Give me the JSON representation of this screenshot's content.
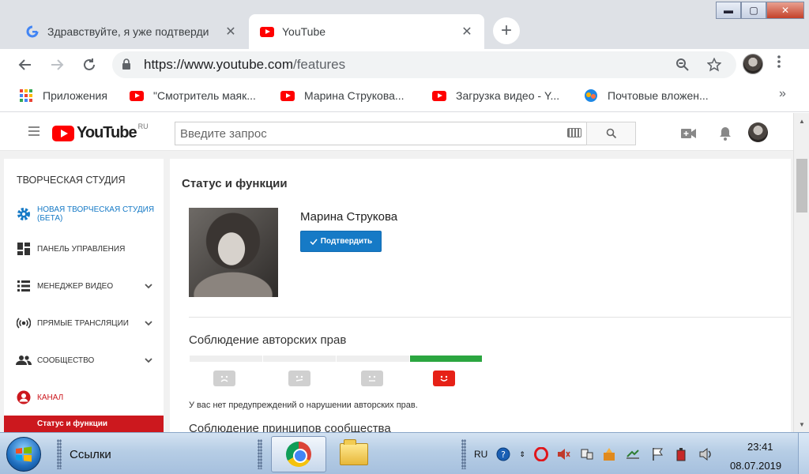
{
  "browser": {
    "tabs": [
      {
        "title": "Здравствуйте, я уже подтверди",
        "close": "✕"
      },
      {
        "title": "YouTube",
        "close": "✕"
      }
    ],
    "new_tab": "+",
    "window_buttons": {
      "minimize": "▬",
      "maximize": "▢",
      "close": "✕"
    },
    "url_host": "https://www.youtube.com",
    "url_path": "/features",
    "bookmarks": [
      {
        "label": "Приложения"
      },
      {
        "label": "\"Смотритель маяк..."
      },
      {
        "label": "Марина Струкова..."
      },
      {
        "label": "Загрузка видео - Y..."
      },
      {
        "label": "Почтовые вложен..."
      }
    ],
    "more_bookmarks": "»"
  },
  "youtube": {
    "logo_word": "YouTube",
    "logo_country": "RU",
    "search_placeholder": "Введите запрос"
  },
  "sidebar": {
    "heading": "ТВОРЧЕСКАЯ СТУДИЯ",
    "items": [
      {
        "label": "НОВАЯ ТВОРЧЕСКАЯ СТУДИЯ (БЕТА)",
        "icon": "gear-icon",
        "accent": true
      },
      {
        "label": "ПАНЕЛЬ УПРАВЛЕНИЯ",
        "icon": "dashboard-icon"
      },
      {
        "label": "МЕНЕДЖЕР ВИДЕО",
        "icon": "video-manager-icon",
        "expandable": true
      },
      {
        "label": "ПРЯМЫЕ ТРАНСЛЯЦИИ",
        "icon": "live-icon",
        "expandable": true
      },
      {
        "label": "СООБЩЕСТВО",
        "icon": "community-icon",
        "expandable": true
      },
      {
        "label": "КАНАЛ",
        "icon": "channel-icon",
        "accent_red": true
      }
    ],
    "selected_sub": "Статус и функции"
  },
  "main": {
    "title": "Статус и функции",
    "profile_name": "Марина Струкова",
    "confirm_label": "Подтвердить",
    "copyright_title": "Соблюдение авторских прав",
    "copyright_notice": "У вас нет предупреждений о нарушении авторских прав.",
    "community_title": "Соблюдение принципов сообщества",
    "strike_levels": 4,
    "current_level": 4
  },
  "taskbar": {
    "links_label": "Ссылки",
    "lang": "RU",
    "time": "23:41",
    "date": "08.07.2019"
  },
  "colors": {
    "youtube_red": "#ff0000",
    "confirm_blue": "#167ac6",
    "good_green": "#2ba640",
    "studio_blue": "#167ac6",
    "sidebar_selected": "#cc181e"
  }
}
